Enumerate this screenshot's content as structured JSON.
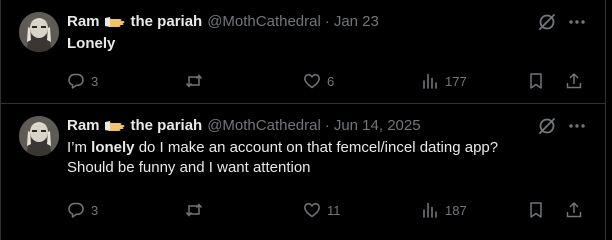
{
  "posts": [
    {
      "author": {
        "display_name": "Ram",
        "display_name_suffix": "the pariah",
        "badge_icon": "hand-emoji-icon",
        "handle": "@MothCathedral",
        "separator": "·",
        "date": "Jan 23"
      },
      "text_segments": [
        {
          "text": "Lonely",
          "bold": true
        }
      ],
      "actions": {
        "replies": "3",
        "reposts": "",
        "likes": "6",
        "views": "177"
      }
    },
    {
      "author": {
        "display_name": "Ram",
        "display_name_suffix": "the pariah",
        "badge_icon": "hand-emoji-icon",
        "handle": "@MothCathedral",
        "separator": "·",
        "date": "Jun 14, 2025"
      },
      "text_segments": [
        {
          "text": "I’m ",
          "bold": false
        },
        {
          "text": "lonely",
          "bold": true
        },
        {
          "text": " do I make an account on that femcel/incel dating app? Should be funny and I want attention",
          "bold": false
        }
      ],
      "actions": {
        "replies": "3",
        "reposts": "",
        "likes": "11",
        "views": "187"
      }
    }
  ],
  "colors": {
    "background": "#000000",
    "text": "#e7e9ea",
    "muted": "#71767b",
    "border": "#2f3336"
  }
}
